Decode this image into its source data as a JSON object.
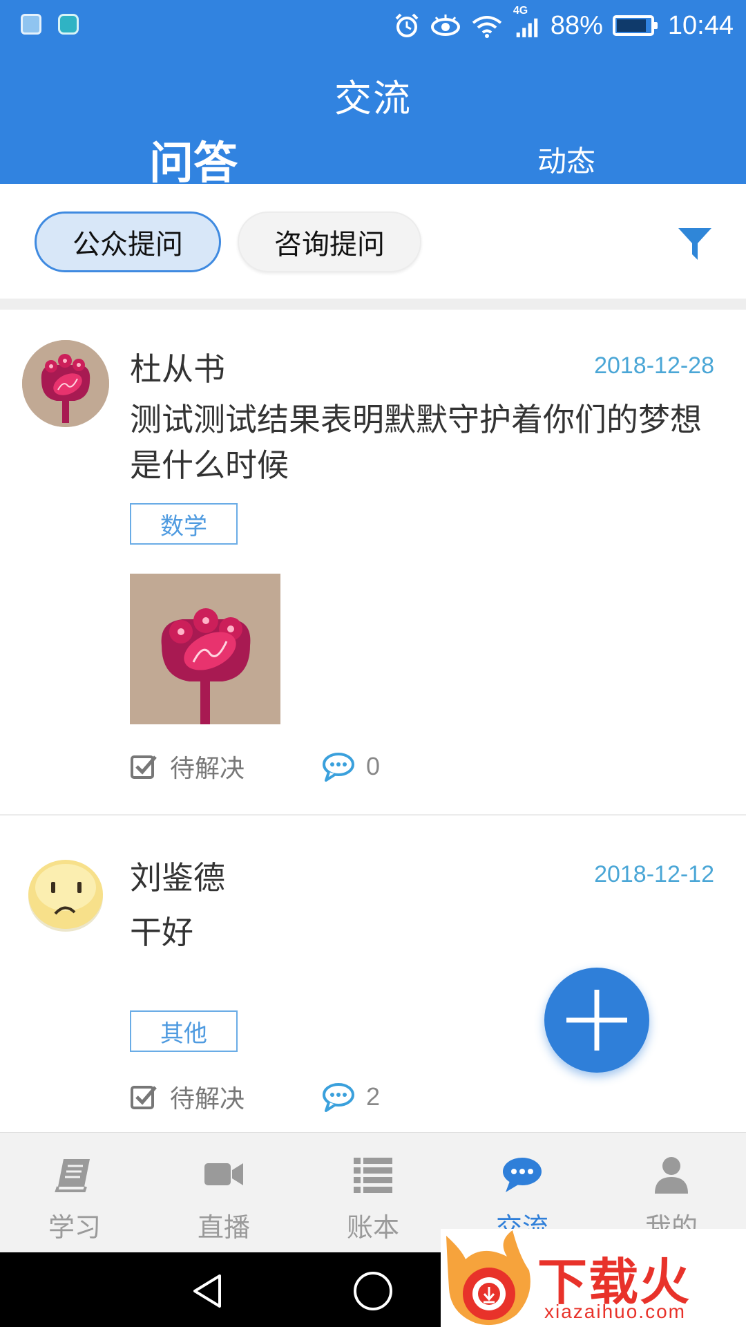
{
  "status_bar": {
    "network": "4G",
    "battery": "88%",
    "battery_level": 0.88,
    "time": "10:44"
  },
  "header": {
    "title": "交流",
    "tabs": [
      {
        "label": "问答",
        "active": true
      },
      {
        "label": "动态",
        "active": false
      }
    ]
  },
  "filters": {
    "chips": [
      {
        "label": "公众提问",
        "active": true
      },
      {
        "label": "咨询提问",
        "active": false
      }
    ],
    "filter_icon": "funnel-icon"
  },
  "posts": [
    {
      "author": "杜从书",
      "date": "2018-12-28",
      "content": "测试测试结果表明默默守护着你们的梦想是什么时候",
      "tag": "数学",
      "has_image": true,
      "status": "待解决",
      "comment_count": "0"
    },
    {
      "author": "刘鉴德",
      "date": "2018-12-12",
      "content": "干好",
      "tag": "其他",
      "has_image": false,
      "status": "待解决",
      "comment_count": "2"
    }
  ],
  "fab": {
    "icon": "plus-icon"
  },
  "bottom_nav": [
    {
      "label": "学习",
      "icon": "book-icon",
      "active": false
    },
    {
      "label": "直播",
      "icon": "video-camera-icon",
      "active": false
    },
    {
      "label": "账本",
      "icon": "list-icon",
      "active": false
    },
    {
      "label": "交流",
      "icon": "chat-bubble-icon",
      "active": true
    },
    {
      "label": "我的",
      "icon": "user-icon",
      "active": false
    }
  ],
  "watermark": {
    "text": "下载火",
    "url": "xiazaihuo.com"
  },
  "colors": {
    "primary": "#3183e0",
    "accent_blue": "#2f7fd9",
    "date_blue": "#4aa6d6",
    "tag_blue": "#4f9be0"
  }
}
